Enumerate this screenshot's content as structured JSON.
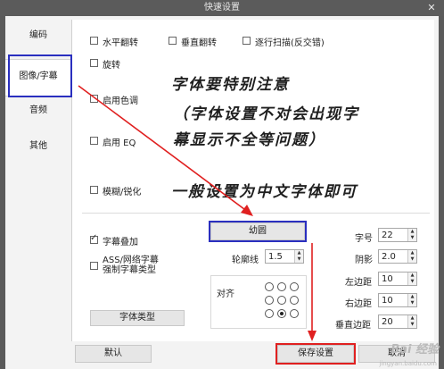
{
  "window": {
    "title": "快速设置",
    "close": "✕"
  },
  "sidebar": {
    "items": [
      {
        "label": "编码"
      },
      {
        "label": "图像/字幕",
        "selected": true
      },
      {
        "label": "音频"
      },
      {
        "label": "其他"
      }
    ]
  },
  "image": {
    "options": [
      {
        "label": "水平翻转",
        "checked": false
      },
      {
        "label": "垂直翻转",
        "checked": false
      },
      {
        "label": "逐行扫描(反交错)",
        "checked": false
      },
      {
        "label": "旋转",
        "checked": false
      },
      {
        "label": "启用色调",
        "checked": false
      },
      {
        "label": "启用 EQ",
        "checked": false
      },
      {
        "label": "模糊/锐化",
        "checked": false
      }
    ]
  },
  "subtitle": {
    "overlay": {
      "label": "字幕叠加",
      "checked": true
    },
    "force_ass": {
      "label_line1": "ASS/网络字幕",
      "label_line2": "强制字幕类型",
      "checked": false
    },
    "font_button": "字体类型",
    "font_name": "幼圆",
    "outline": {
      "label": "轮廓线",
      "value": "1.5"
    },
    "align_label": "对齐",
    "align_selected": 7,
    "fields": [
      {
        "label": "字号",
        "value": "22"
      },
      {
        "label": "阴影",
        "value": "2.0"
      },
      {
        "label": "左边距",
        "value": "10"
      },
      {
        "label": "右边距",
        "value": "10"
      },
      {
        "label": "垂直边距",
        "value": "20"
      }
    ]
  },
  "footer": {
    "default": "默认",
    "save": "保存设置",
    "cancel": "取消"
  },
  "annotation": {
    "line1": "字体要特别注意",
    "line2": "（字体设置不对会出现字",
    "line3": "幕显示不全等问题）",
    "line4": "一般设置为中文字体即可",
    "color": "#e02020",
    "box_color": "#2a2fbf"
  },
  "watermark": {
    "text": "Bai 经验",
    "sub": "jingyan.baidu.com"
  }
}
